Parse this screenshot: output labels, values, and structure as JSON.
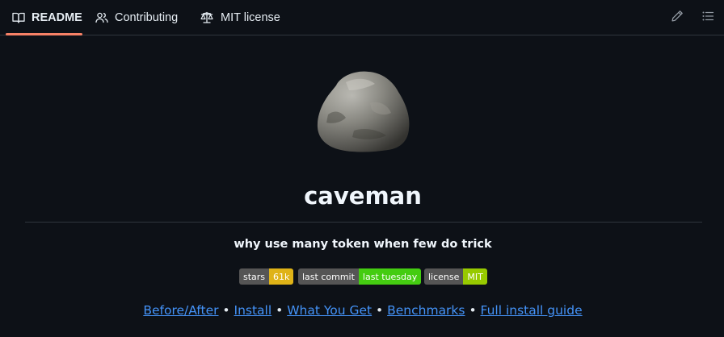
{
  "tabs": [
    {
      "label": "README",
      "icon": "book-icon",
      "active": true
    },
    {
      "label": "Contributing",
      "icon": "people-icon",
      "active": false
    },
    {
      "label": "MIT license",
      "icon": "law-icon",
      "active": false
    }
  ],
  "actions": {
    "edit_icon": "pencil-icon",
    "outline_icon": "list-unordered-icon"
  },
  "readme": {
    "logo": "rock-image",
    "title": "caveman",
    "tagline": "why use many token when few do trick",
    "badges": [
      {
        "label": "stars",
        "value": "61k",
        "color": "#dfb317"
      },
      {
        "label": "last commit",
        "value": "last tuesday",
        "color": "#44cc11"
      },
      {
        "label": "license",
        "value": "MIT",
        "color": "#97ca00"
      }
    ],
    "links": [
      "Before/After",
      "Install",
      "What You Get",
      "Benchmarks",
      "Full install guide"
    ],
    "link_separator": "•"
  },
  "colors": {
    "background": "#0d1117",
    "accent_underline": "#f78166",
    "link": "#4493f8",
    "border": "#30363d"
  }
}
